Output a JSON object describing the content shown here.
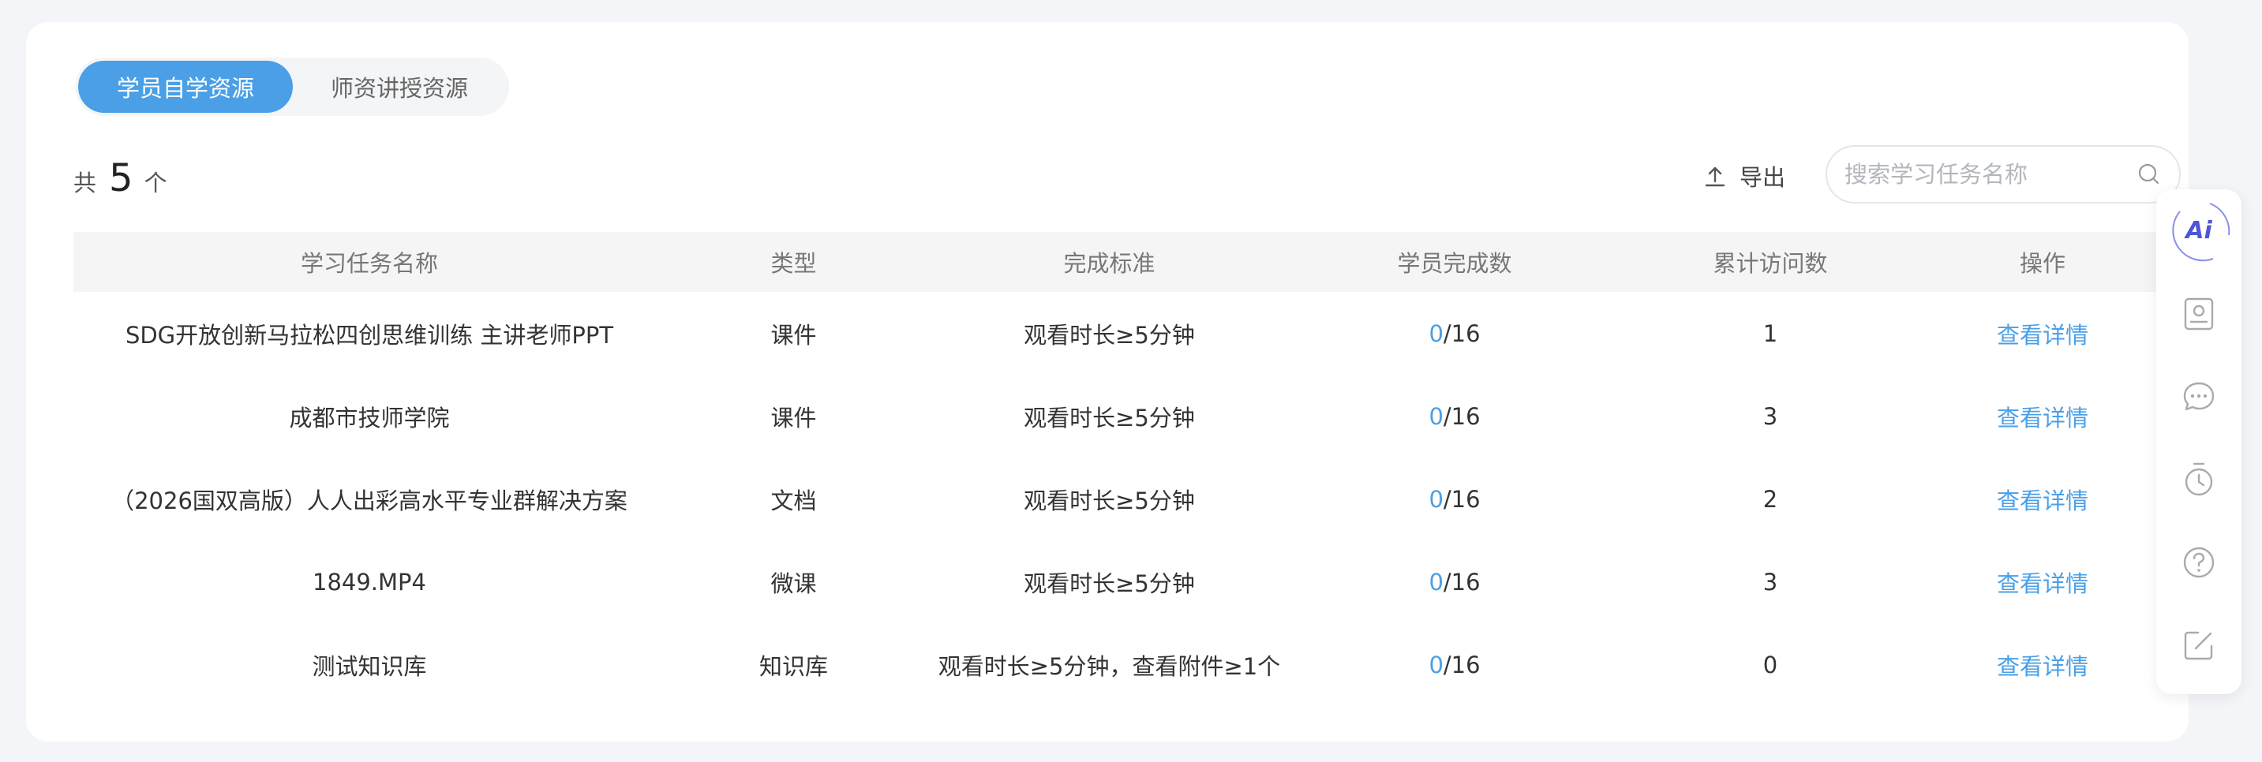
{
  "tabs": [
    {
      "label": "学员自学资源",
      "active": true
    },
    {
      "label": "师资讲授资源",
      "active": false
    }
  ],
  "count": {
    "prefix": "共",
    "value": "5",
    "suffix": "个"
  },
  "export": {
    "label": "导出",
    "icon": "upload-icon"
  },
  "search": {
    "placeholder": "搜索学习任务名称",
    "value": "",
    "icon": "search-icon"
  },
  "table": {
    "headers": [
      "学习任务名称",
      "类型",
      "完成标准",
      "学员完成数",
      "累计访问数",
      "操作"
    ],
    "rows": [
      {
        "name": "SDG开放创新马拉松四创思维训练 主讲老师PPT",
        "type": "课件",
        "standard": "观看时长≥5分钟",
        "done": "0",
        "total": "/16",
        "visits": "1",
        "action": "查看详情"
      },
      {
        "name": "成都市技师学院",
        "type": "课件",
        "standard": "观看时长≥5分钟",
        "done": "0",
        "total": "/16",
        "visits": "3",
        "action": "查看详情"
      },
      {
        "name": "（2026国双高版）人人出彩高水平专业群解决方案",
        "type": "文档",
        "standard": "观看时长≥5分钟",
        "done": "0",
        "total": "/16",
        "visits": "2",
        "action": "查看详情"
      },
      {
        "name": "1849.MP4",
        "type": "微课",
        "standard": "观看时长≥5分钟",
        "done": "0",
        "total": "/16",
        "visits": "3",
        "action": "查看详情"
      },
      {
        "name": "测试知识库",
        "type": "知识库",
        "standard": "观看时长≥5分钟，查看附件≥1个",
        "done": "0",
        "total": "/16",
        "visits": "0",
        "action": "查看详情"
      }
    ]
  },
  "toolbar": {
    "ai_label": "Ai",
    "icons": [
      "ai-icon",
      "contact-card-icon",
      "chat-icon",
      "timer-icon",
      "help-icon",
      "edit-icon"
    ]
  },
  "colors": {
    "accent": "#4a9fe6",
    "ai": "#4e56d8",
    "header_bg": "#f5f5f5"
  }
}
